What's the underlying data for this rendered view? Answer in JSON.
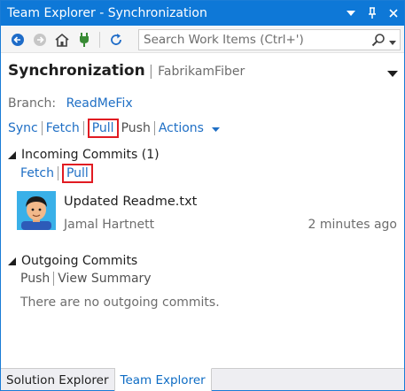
{
  "window": {
    "title": "Team Explorer - Synchronization",
    "accent_color": "#0e78d7"
  },
  "titlebar_buttons": [
    {
      "name": "dropdown-arrow-icon"
    },
    {
      "name": "pin-icon"
    },
    {
      "name": "close-icon"
    }
  ],
  "toolbar": {
    "icons": [
      "back-arrow-icon",
      "forward-arrow-icon",
      "home-icon",
      "connect-plug-icon",
      "refresh-icon"
    ],
    "search_placeholder": "Search Work Items (Ctrl+')"
  },
  "header": {
    "title": "Synchronization",
    "subtitle": "FabrikamFiber"
  },
  "branch": {
    "label": "Branch:",
    "name": "ReadMeFix"
  },
  "actions": {
    "sync": "Sync",
    "fetch": "Fetch",
    "pull": "Pull",
    "push": "Push",
    "actions": "Actions"
  },
  "incoming": {
    "title": "Incoming Commits (1)",
    "fetch": "Fetch",
    "pull": "Pull",
    "commits": [
      {
        "message": "Updated Readme.txt",
        "author": "Jamal Hartnett",
        "time": "2 minutes ago"
      }
    ]
  },
  "outgoing": {
    "title": "Outgoing Commits",
    "push": "Push",
    "view_summary": "View Summary",
    "empty_message": "There are no outgoing commits."
  },
  "tabs": [
    {
      "label": "Solution Explorer",
      "active": false
    },
    {
      "label": "Team Explorer",
      "active": true
    }
  ],
  "colors": {
    "link": "#1f6fc5",
    "highlight_border": "#e11b22"
  }
}
